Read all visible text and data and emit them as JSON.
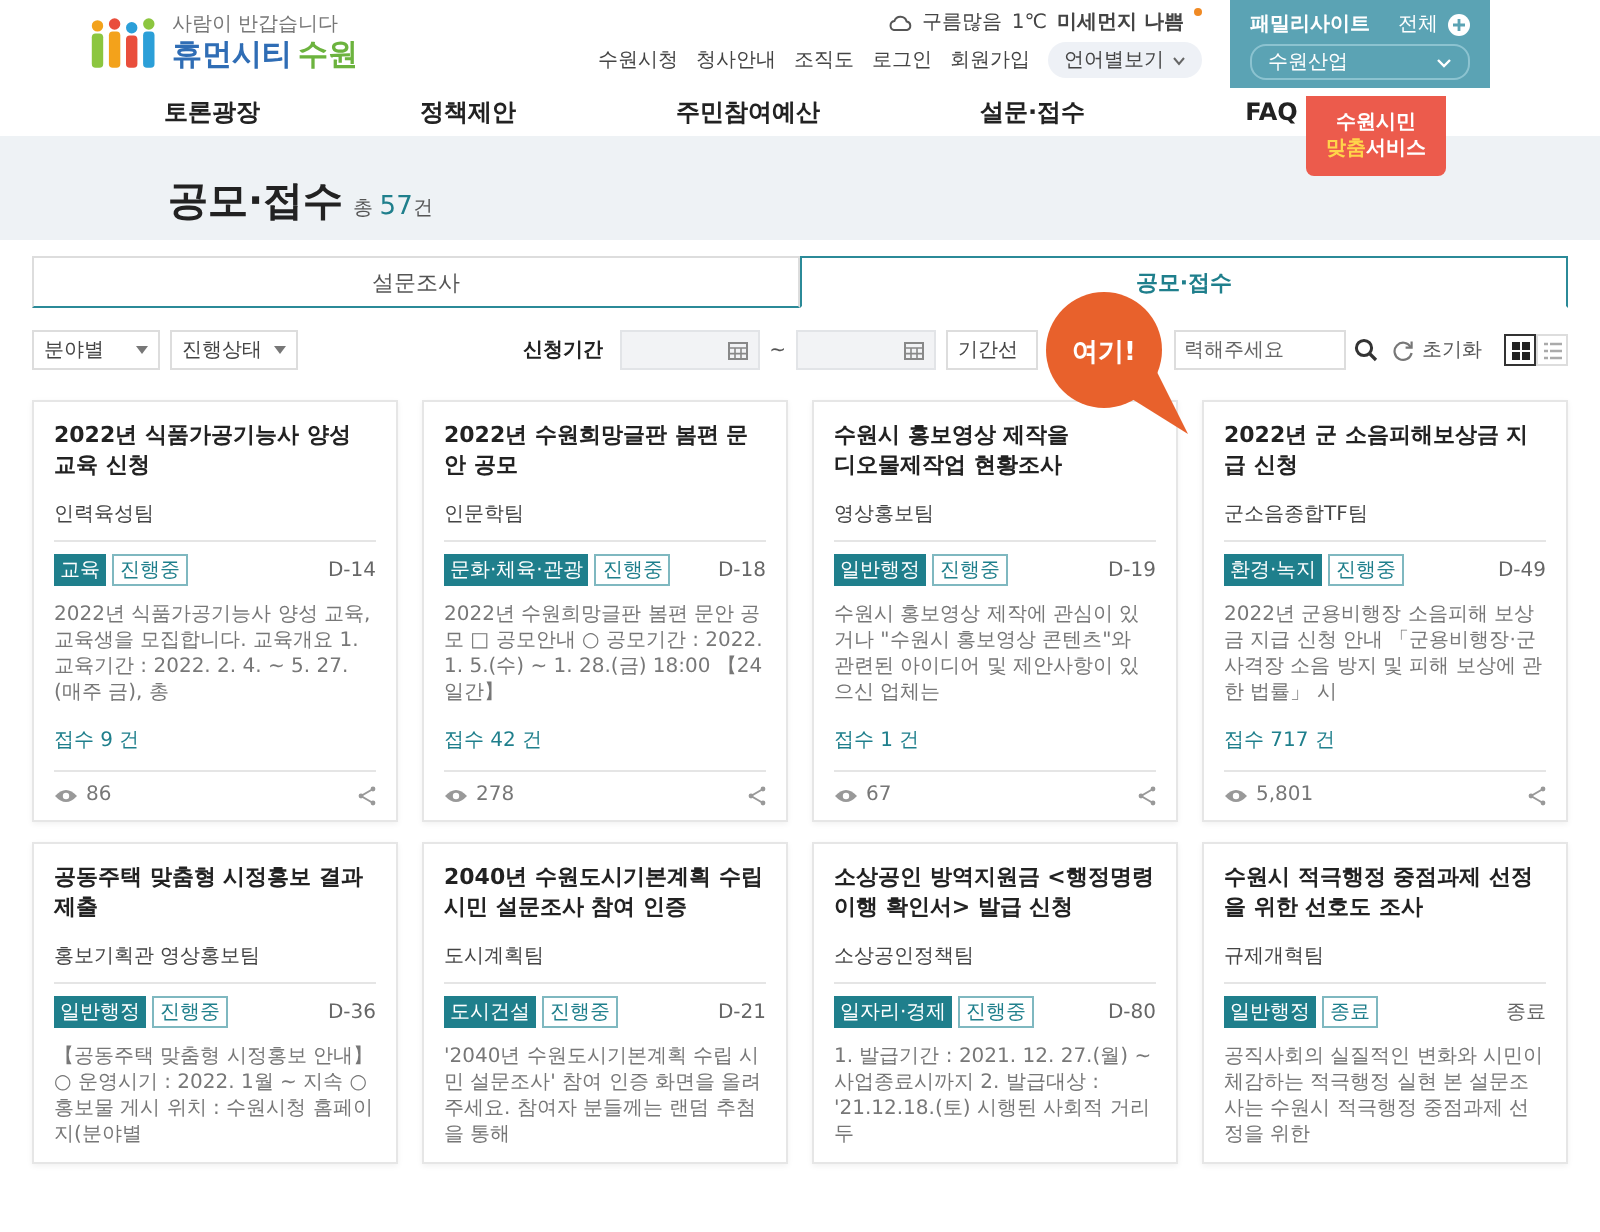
{
  "header": {
    "logo_tagline": "사람이 반갑습니다",
    "logo_brand": "휴먼시티",
    "logo_city": "수원",
    "weather": {
      "condition": "구름많음",
      "temperature": "1℃",
      "dust": "미세먼지 나쁨"
    },
    "util_links": [
      "수원시청",
      "청사안내",
      "조직도",
      "로그인",
      "회원가입"
    ],
    "language_select": "언어별보기"
  },
  "family_site": {
    "title": "패밀리사이트",
    "all_link": "전체",
    "select": "수원산업"
  },
  "citizen_service": {
    "line1": "수원시민",
    "highlight": "맞춤",
    "rest": "서비스"
  },
  "nav": [
    "토론광장",
    "정책제안",
    "주민참여예산",
    "설문·접수",
    "FAQ"
  ],
  "page": {
    "title": "공모·접수",
    "total_prefix": "총",
    "total": "57",
    "total_suffix": "건"
  },
  "tabs": [
    {
      "label": "설문조사",
      "selected": false
    },
    {
      "label": "공모·접수",
      "selected": true
    }
  ],
  "filters": {
    "field_select": "분야별",
    "status_select": "진행상태",
    "period_label": "신청기간",
    "range_separator": "~",
    "period_type_select": "기간선",
    "search_placeholder": "력해주세요",
    "reset_label": "초기화",
    "views": [
      {
        "kind": "grid",
        "selected": true
      },
      {
        "kind": "list",
        "selected": false
      }
    ]
  },
  "annotation": {
    "text": "여기!"
  },
  "cards": [
    {
      "title_lines": [
        "2022년 식품가공기능사 양성",
        "교육 신청"
      ],
      "department": "인력육성팀",
      "category": "교육",
      "status": "진행중",
      "dday": "D-14",
      "description": "2022년 식품가공기능사 양성 교육, 교육생을 모집합니다. 교육개요 1. 교육기간 : 2022. 2. 4. ~ 5. 27.(매주 금), 총",
      "count": "접수 9 건",
      "views": "86"
    },
    {
      "title_lines": [
        "2022년 수원희망글판 봄편 문",
        "안 공모"
      ],
      "department": "인문학팀",
      "category": "문화·체육·관광",
      "status": "진행중",
      "dday": "D-18",
      "description": "2022년 수원희망글판 봄편 문안 공모 □ 공모안내 ○ 공모기간 : 2022. 1. 5.(수) ~ 1. 28.(금) 18:00 【24일간】",
      "count": "접수 42 건",
      "views": "278"
    },
    {
      "title_lines": [
        "수원시 홍보영상 제작을",
        "디오물제작업 현황조사"
      ],
      "department": "영상홍보팀",
      "category": "일반행정",
      "status": "진행중",
      "dday": "D-19",
      "description": "수원시 홍보영상 제작에 관심이 있거나 \"수원시 홍보영상 콘텐츠\"와 관련된 아이디어 및 제안사항이 있으신 업체는",
      "count": "접수 1 건",
      "views": "67"
    },
    {
      "title_lines": [
        "2022년 군 소음피해보상금 지",
        "급 신청"
      ],
      "department": "군소음종합TF팀",
      "category": "환경·녹지",
      "status": "진행중",
      "dday": "D-49",
      "description": "2022년 군용비행장 소음피해 보상금 지급 신청 안내 「군용비행장·군사격장 소음 방지 및 피해 보상에 관한 법률」 시",
      "count": "접수 717 건",
      "views": "5,801"
    },
    {
      "title_lines": [
        "공동주택 맞춤형 시정홍보 결과",
        "제출"
      ],
      "department": "홍보기획관 영상홍보팀",
      "category": "일반행정",
      "status": "진행중",
      "dday": "D-36",
      "description": "【공동주택 맞춤형 시정홍보 안내】 ○ 운영시기 : 2022. 1월 ~ 지속 ○ 홍보물 게시 위치 : 수원시청 홈페이지(분야별"
    },
    {
      "title_lines": [
        "2040년 수원도시기본계획 수립",
        "시민 설문조사 참여 인증"
      ],
      "department": "도시계획팀",
      "category": "도시건설",
      "status": "진행중",
      "dday": "D-21",
      "description": "'2040년 수원도시기본계획 수립 시민 설문조사' 참여 인증 화면을 올려주세요. 참여자 분들께는 랜덤 추첨을 통해"
    },
    {
      "title_lines": [
        "소상공인 방역지원금 <행정명령",
        "이행 확인서> 발급 신청"
      ],
      "department": "소상공인정책팀",
      "category": "일자리·경제",
      "status": "진행중",
      "dday": "D-80",
      "description": "1. 발급기간 : 2021. 12. 27.(월) ~ 사업종료시까지 2. 발급대상 : '21.12.18.(토) 시행된 사회적 거리두"
    },
    {
      "title_lines": [
        "수원시 적극행정 중점과제 선정",
        "을 위한 선호도 조사"
      ],
      "department": "규제개혁팀",
      "category": "일반행정",
      "status": "종료",
      "dday": "종료",
      "description": "공직사회의 실질적인 변화와 시민이 체감하는 적극행정 실현 본 설문조사는 수원시 적극행정 중점과제 선정을 위한"
    }
  ]
}
